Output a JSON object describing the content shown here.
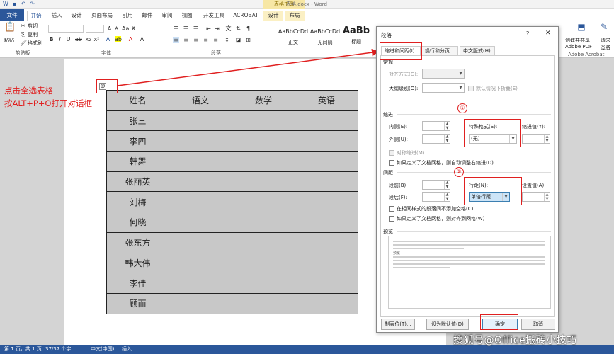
{
  "app": {
    "title": "表格.docx - Word",
    "contextual_tab_header": "表格工具"
  },
  "tabs": [
    "文件",
    "开始",
    "插入",
    "设计",
    "页面布局",
    "引用",
    "邮件",
    "审阅",
    "视图",
    "开发工具",
    "ACROBAT",
    "设计",
    "布局"
  ],
  "ribbon": {
    "clipboard": {
      "label": "剪贴板",
      "paste": "粘贴",
      "cut": "剪切",
      "copy": "复制",
      "format_painter": "格式刷"
    },
    "font": {
      "label": "字体"
    },
    "paragraph": {
      "label": "段落"
    },
    "styles": {
      "previews": [
        "AaBbCcDd",
        "AaBbCcDd",
        "AaBb"
      ],
      "names": [
        "正文",
        "无间隔",
        "标题"
      ]
    },
    "acrobat": {
      "create_share": "创建并共享",
      "adobe_pdf": "Adobe PDF",
      "request_sign": "请求",
      "sign": "签名",
      "label": "Adobe Acrobat"
    }
  },
  "annotation": {
    "line1": "点击全选表格",
    "line2": "按ALT+P+O打开对话框",
    "step1": "①",
    "step2": "②"
  },
  "table": {
    "rows": [
      [
        "姓名",
        "语文",
        "数学",
        "英语"
      ],
      [
        "张三",
        "",
        "",
        ""
      ],
      [
        "李四",
        "",
        "",
        ""
      ],
      [
        "韩舞",
        "",
        "",
        ""
      ],
      [
        "张丽英",
        "",
        "",
        ""
      ],
      [
        "刘梅",
        "",
        "",
        ""
      ],
      [
        "何晓",
        "",
        "",
        ""
      ],
      [
        "张东方",
        "",
        "",
        ""
      ],
      [
        "韩大伟",
        "",
        "",
        ""
      ],
      [
        "李佳",
        "",
        "",
        ""
      ],
      [
        "顾而",
        "",
        "",
        ""
      ]
    ]
  },
  "dialog": {
    "title": "段落",
    "help": "?",
    "close": "✕",
    "tabs": [
      "缩进和间距(I)",
      "换行和分页(P)",
      "中文版式(H)"
    ],
    "general": {
      "section": "常规",
      "alignment": "对齐方式(G):",
      "outline": "大纲级别(O):",
      "collapse": "默认情况下折叠(E)"
    },
    "indent": {
      "section": "缩进",
      "inside": "内侧(E):",
      "outside": "外侧(U):",
      "special": "特殊格式(S):",
      "special_value": "(无)",
      "by": "缩进值(Y):",
      "mirror": "对称缩进(M)",
      "grid": "如果定义了文档网格，则自动调整右缩进(D)"
    },
    "spacing": {
      "section": "间距",
      "before": "段前(B):",
      "after": "段后(F):",
      "line": "行距(N):",
      "line_value": "单倍行距",
      "at": "设置值(A):",
      "no_space": "在相同样式的段落间不添加空格(C)",
      "snap": "如果定义了文档网格，则对齐到网格(W)"
    },
    "preview": {
      "section": "预览",
      "sample": "预览"
    },
    "buttons": {
      "tabs": "制表位(T)...",
      "default": "设为默认值(D)",
      "ok": "确定",
      "cancel": "取消"
    }
  },
  "status": {
    "page": "第 1 页，共 1 页",
    "words": "37/37 个字",
    "lang": "中文(中国)",
    "mode": "插入"
  },
  "watermark": "搜狐号@Office搬砖小技巧",
  "colors": {
    "accent": "#2b579a",
    "annotation": "#e02020",
    "contextual": "#f7e7a5"
  }
}
